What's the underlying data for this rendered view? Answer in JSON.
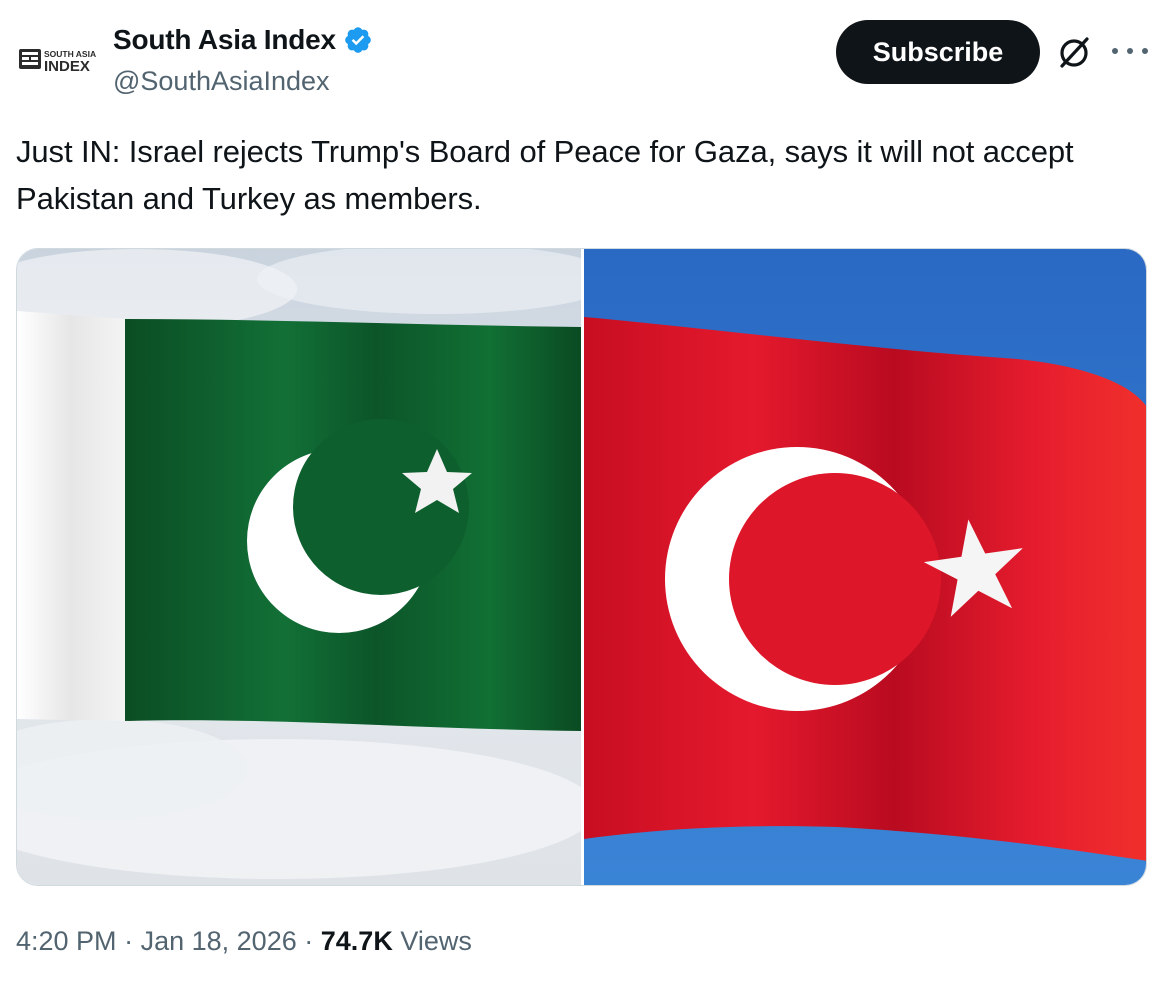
{
  "author": {
    "display_name": "South Asia Index",
    "handle": "@SouthAsiaIndex",
    "verified": true,
    "avatar_logo_top": "SOUTH ASIA",
    "avatar_logo_bottom": "INDEX"
  },
  "actions": {
    "subscribe_label": "Subscribe",
    "grok_icon": "grok-icon",
    "more_icon": "more-dots-icon"
  },
  "post": {
    "text": "Just IN: Israel rejects Trump's Board of Peace for Gaza, says it will not accept Pakistan and Turkey as members.",
    "media": [
      {
        "name": "pakistan-flag-photo"
      },
      {
        "name": "turkey-flag-photo"
      }
    ]
  },
  "meta": {
    "time": "4:20 PM",
    "separator_1": "·",
    "date": "Jan 18, 2026",
    "separator_2": "·",
    "views_count": "74.7K",
    "views_label": "Views"
  },
  "colors": {
    "text_primary": "#0f1419",
    "text_secondary": "#536471",
    "verified_blue": "#1d9bf0",
    "pakistan_green": "#0d5c2c",
    "turkey_red": "#e3112b",
    "sky_blue": "#2f73c9"
  }
}
